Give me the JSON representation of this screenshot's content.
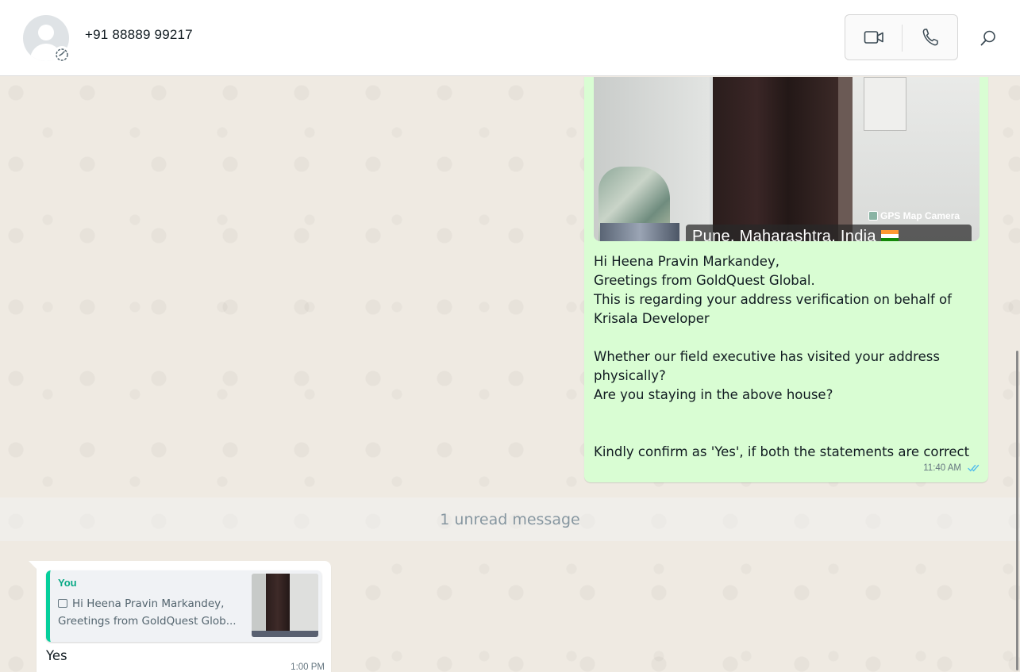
{
  "header": {
    "contact_name": "+91 88889 99217"
  },
  "outgoing_message": {
    "image": {
      "gps_badge": "GPS Map Camera",
      "location": "Pune, Maharashtra, India"
    },
    "lines": [
      "Hi Heena Pravin Markandey,",
      "Greetings from GoldQuest Global.",
      "This is regarding your address verification on behalf of",
      "Krisala Developer",
      "",
      "Whether our field executive has visited your address",
      "physically?",
      "Are you staying in the above house?",
      "",
      "",
      "Kindly confirm as 'Yes', if both the statements are correct"
    ],
    "time": "11:40 AM",
    "status": "read",
    "tick_color": "#53bdeb"
  },
  "unread_divider": "1 unread message",
  "incoming_message": {
    "quote": {
      "author": "You",
      "line1": "Hi Heena Pravin Markandey,",
      "line2": "Greetings from GoldQuest Glob..."
    },
    "text": "Yes",
    "time": "1:00 PM"
  },
  "colors": {
    "outgoing_bubble": "#d9fdd3",
    "incoming_bubble": "#ffffff",
    "quote_accent": "#06cf9c",
    "chat_background": "#efeae2"
  },
  "icons": [
    "avatar-placeholder",
    "status-ring-icon",
    "video-call-icon",
    "voice-call-icon",
    "search-icon",
    "double-check-icon",
    "image-icon"
  ]
}
